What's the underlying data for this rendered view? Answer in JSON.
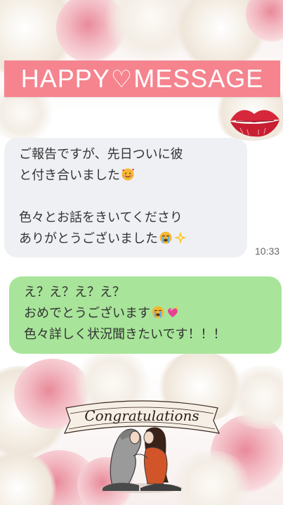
{
  "header": {
    "banner_left": "HAPPY",
    "banner_right": "MESSAGE",
    "heart_icon": "heart-outline-icon"
  },
  "messages": {
    "received": {
      "line1": "ご報告ですが、先日ついに彼",
      "line2": "と付き合いました",
      "line2_emoji": "smiling-face-with-hearts-icon",
      "line3": "色々とお話をきいてくださり",
      "line4": "ありがとうございました",
      "line4_emojis": [
        "loudly-crying-face-icon",
        "sparkle-icon"
      ],
      "time": "10:33"
    },
    "sent": {
      "line1": "え？え？え？え？",
      "line2": "おめでとうございます",
      "line2_emojis": [
        "loudly-crying-face-icon",
        "sparkling-heart-icon"
      ],
      "line3": "色々詳しく状況聞きたいです！！！"
    }
  },
  "footer": {
    "congrats_text": "Congratulations"
  },
  "colors": {
    "banner": "#f5848f",
    "received_bubble": "#eef0f4",
    "sent_bubble": "#a8e59a",
    "lips": "#d6283a"
  }
}
